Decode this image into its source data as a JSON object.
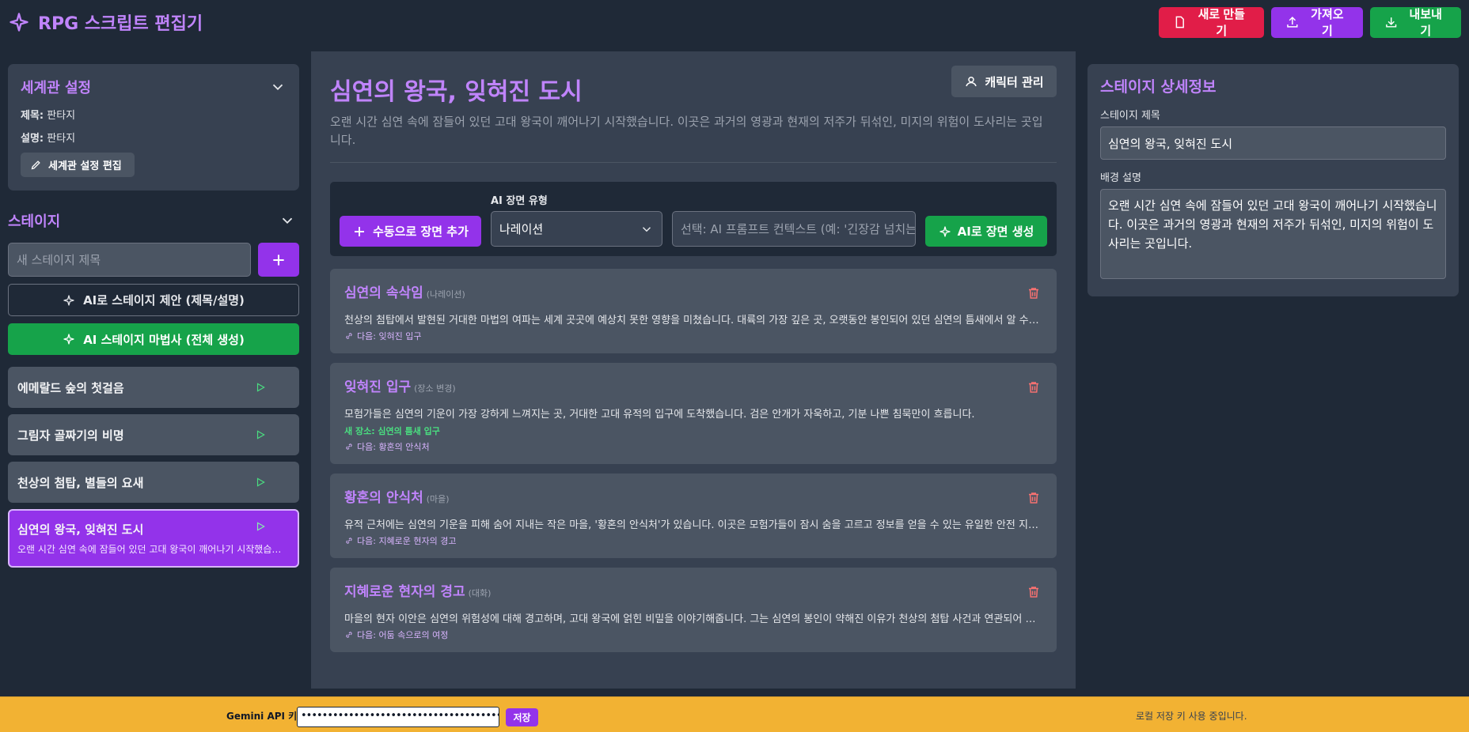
{
  "app": {
    "title": "RPG 스크립트 편집기"
  },
  "header": {
    "new_label": "새로 만들기",
    "import_label": "가져오기",
    "export_label": "내보내기"
  },
  "world": {
    "section_title": "세계관 설정",
    "title_label": "제목:",
    "title_value": "판타지",
    "desc_label": "설명:",
    "desc_value": "판타지",
    "edit_label": "세계관 설정 편집"
  },
  "stages": {
    "section_title": "스테이지",
    "new_placeholder": "새 스테이지 제목",
    "suggest_label": "AI로 스테이지 제안 (제목/설명)",
    "wizard_label": "AI 스테이지 마법사 (전체 생성)",
    "items": [
      {
        "title": "에메랄드 숲의 첫걸음"
      },
      {
        "title": "그림자 골짜기의 비명"
      },
      {
        "title": "천상의 첨탑, 별들의 요새"
      },
      {
        "title": "심연의 왕국, 잊혀진 도시",
        "desc": "오랜 시간 심연 속에 잠들어 있던 고대 왕국이 깨어나기 시작했습니다. 이곳은 과거의 영광과 현재의 저주가 뒤섞인, 미지의 위험이 도사리는 곳입니다."
      }
    ]
  },
  "main": {
    "title": "심연의 왕국, 잊혀진 도시",
    "description": "오랜 시간 심연 속에 잠들어 있던 고대 왕국이 깨어나기 시작했습니다. 이곳은 과거의 영광과 현재의 저주가 뒤섞인, 미지의 위험이 도사리는 곳입니다.",
    "character_btn": "캐릭터 관리",
    "add_scene_label": "수동으로 장면 추가",
    "ai_type_label": "AI 장면 유형",
    "ai_type_value": "나레이션",
    "ai_context_placeholder": "선택: AI 프롬프트 컨텍스트 (예: '긴장감 넘치는",
    "ai_gen_label": "AI로 장면 생성",
    "scenes": [
      {
        "title": "심연의 속삭임",
        "type": "(나레이션)",
        "body": "천상의 첨탑에서 발현된 거대한 마법의 여파는 세계 곳곳에 예상치 못한 영향을 미쳤습니다. 대륙의 가장 깊은 곳, 오랫동안 봉인되어 있던 심연의 틈새에서 알 수 없는 기운이 새어 나오기 시작했습니다.",
        "next": "다음: 잊혀진 입구"
      },
      {
        "title": "잊혀진 입구",
        "type": "(장소 변경)",
        "body": "모험가들은 심연의 기운이 가장 강하게 느껴지는 곳, 거대한 고대 유적의 입구에 도착했습니다. 검은 안개가 자욱하고, 기분 나쁜 침묵만이 흐릅니다.",
        "location": "새 장소: 심연의 틈새 입구",
        "next": "다음: 황혼의 안식처"
      },
      {
        "title": "황혼의 안식처",
        "type": "(마을)",
        "body": "유적 근처에는 심연의 기운을 피해 숨어 지내는 작은 마을, '황혼의 안식처'가 있습니다. 이곳은 모험가들이 잠시 숨을 고르고 정보를 얻을 수 있는 유일한 안전 지대입니다.",
        "next": "다음: 지혜로운 현자의 경고"
      },
      {
        "title": "지혜로운 현자의 경고",
        "type": "(대화)",
        "body": "마을의 현자 이안은 심연의 위험성에 대해 경고하며, 고대 왕국에 얽힌 비밀을 이야기해줍니다. 그는 심연의 봉인이 약해진 이유가 천상의 첨탑 사건과 연관되어 있다고 말합니다.",
        "next": "다음: 어둠 속으로의 여정"
      }
    ]
  },
  "details": {
    "title": "스테이지 상세정보",
    "stage_title_label": "스테이지 제목",
    "stage_title_value": "심연의 왕국, 잊혀진 도시",
    "bg_label": "배경 설명",
    "bg_value": "오랜 시간 심연 속에 잠들어 있던 고대 왕국이 깨어나기 시작했습니다. 이곳은 과거의 영광과 현재의 저주가 뒤섞인, 미지의 위험이 도사리는 곳입니다."
  },
  "footer": {
    "api_label": "Gemini API 키:",
    "api_value": "••••••••••••••••••••••••••••••••••••••",
    "save_label": "저장",
    "status": "로컬 저장 키 사용 중입니다."
  },
  "colors": {
    "accent": "#9333ea",
    "heading": "#c084fc",
    "danger": "#e11d48",
    "success": "#16a34a",
    "footer": "#f2b233"
  }
}
